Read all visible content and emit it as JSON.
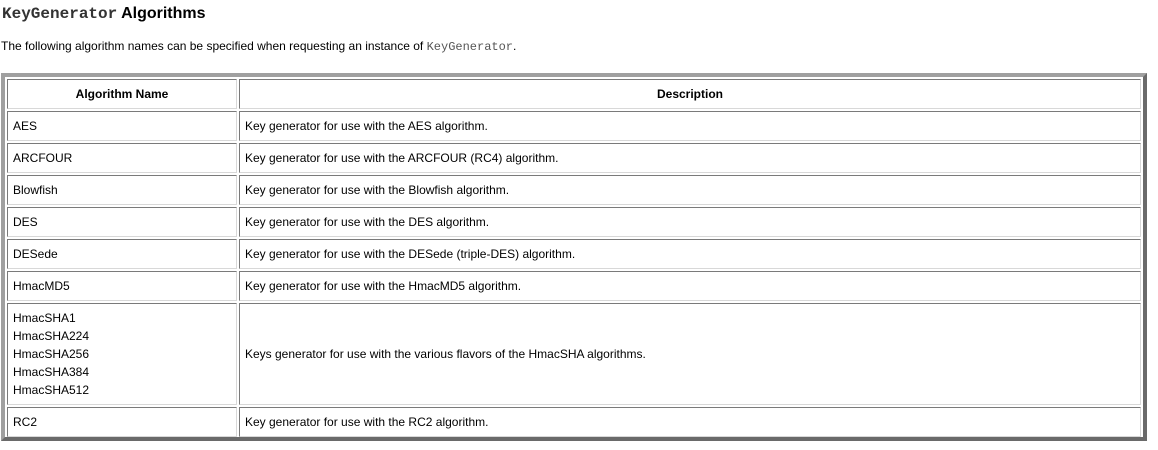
{
  "heading": {
    "code": "KeyGenerator",
    "text": " Algorithms"
  },
  "intro": {
    "text": "The following algorithm names can be specified when requesting an instance of ",
    "code": "KeyGenerator",
    "tail": "."
  },
  "table": {
    "headers": [
      "Algorithm Name",
      "Description"
    ],
    "rows": [
      {
        "names": [
          "AES"
        ],
        "description": "Key generator for use with the AES algorithm."
      },
      {
        "names": [
          "ARCFOUR"
        ],
        "description": "Key generator for use with the ARCFOUR (RC4) algorithm."
      },
      {
        "names": [
          "Blowfish"
        ],
        "description": "Key generator for use with the Blowfish algorithm."
      },
      {
        "names": [
          "DES"
        ],
        "description": "Key generator for use with the DES algorithm."
      },
      {
        "names": [
          "DESede"
        ],
        "description": "Key generator for use with the DESede (triple-DES) algorithm."
      },
      {
        "names": [
          "HmacMD5"
        ],
        "description": "Key generator for use with the HmacMD5 algorithm."
      },
      {
        "names": [
          "HmacSHA1",
          "HmacSHA224",
          "HmacSHA256",
          "HmacSHA384",
          "HmacSHA512"
        ],
        "description": "Keys generator for use with the various flavors of the HmacSHA algorithms."
      },
      {
        "names": [
          "RC2"
        ],
        "description": "Key generator for use with the RC2 algorithm."
      }
    ]
  }
}
